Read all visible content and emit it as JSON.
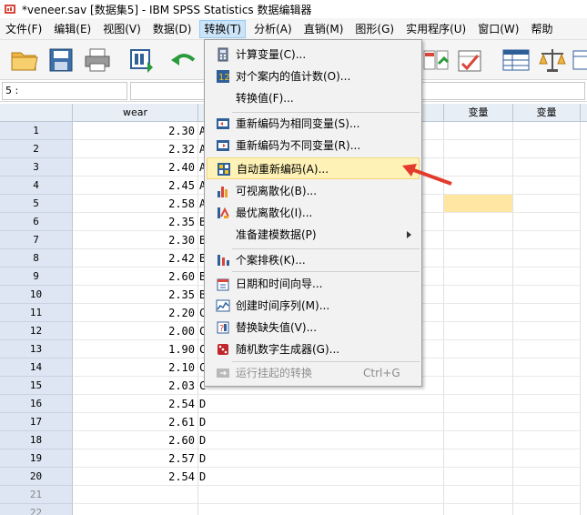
{
  "window": {
    "title": "*veneer.sav [数据集5] - IBM SPSS Statistics 数据编辑器"
  },
  "menubar": {
    "items": [
      "文件(F)",
      "编辑(E)",
      "视图(V)",
      "数据(D)",
      "转换(T)",
      "分析(A)",
      "直销(M)",
      "图形(G)",
      "实用程序(U)",
      "窗口(W)",
      "帮助"
    ],
    "active_index": 4
  },
  "addressbar": {
    "cell_ref": "5 :",
    "cell_value": ""
  },
  "grid": {
    "columns": [
      "wear",
      "变量",
      "变量"
    ],
    "rows": [
      {
        "n": "1",
        "wear": "2.30",
        "brand": "A"
      },
      {
        "n": "2",
        "wear": "2.32",
        "brand": "A"
      },
      {
        "n": "3",
        "wear": "2.40",
        "brand": "A"
      },
      {
        "n": "4",
        "wear": "2.45",
        "brand": "A"
      },
      {
        "n": "5",
        "wear": "2.58",
        "brand": "A"
      },
      {
        "n": "6",
        "wear": "2.35",
        "brand": "B"
      },
      {
        "n": "7",
        "wear": "2.30",
        "brand": "B"
      },
      {
        "n": "8",
        "wear": "2.42",
        "brand": "B"
      },
      {
        "n": "9",
        "wear": "2.60",
        "brand": "B"
      },
      {
        "n": "10",
        "wear": "2.35",
        "brand": "B"
      },
      {
        "n": "11",
        "wear": "2.20",
        "brand": "C"
      },
      {
        "n": "12",
        "wear": "2.00",
        "brand": "C"
      },
      {
        "n": "13",
        "wear": "1.90",
        "brand": "C"
      },
      {
        "n": "14",
        "wear": "2.10",
        "brand": "C"
      },
      {
        "n": "15",
        "wear": "2.03",
        "brand": "C"
      },
      {
        "n": "16",
        "wear": "2.54",
        "brand": "D"
      },
      {
        "n": "17",
        "wear": "2.61",
        "brand": "D"
      },
      {
        "n": "18",
        "wear": "2.60",
        "brand": "D"
      },
      {
        "n": "19",
        "wear": "2.57",
        "brand": "D"
      },
      {
        "n": "20",
        "wear": "2.54",
        "brand": "D"
      },
      {
        "n": "21",
        "wear": "",
        "brand": ""
      },
      {
        "n": "22",
        "wear": "",
        "brand": ""
      }
    ]
  },
  "transform_menu": {
    "items": [
      {
        "label": "计算变量(C)...",
        "icon": "calculator-icon"
      },
      {
        "label": "对个案内的值计数(O)...",
        "icon": "count-icon"
      },
      {
        "label": "转换值(F)...",
        "icon": ""
      },
      {
        "label": "重新编码为相同变量(S)...",
        "icon": "recode-same-icon"
      },
      {
        "label": "重新编码为不同变量(R)...",
        "icon": "recode-different-icon"
      },
      {
        "label": "自动重新编码(A)...",
        "icon": "auto-recode-icon",
        "highlighted": true
      },
      {
        "label": "可视离散化(B)...",
        "icon": "visual-binning-icon"
      },
      {
        "label": "最优离散化(I)...",
        "icon": "optimal-binning-icon"
      },
      {
        "label": "准备建模数据(P)",
        "icon": "",
        "submenu": true
      },
      {
        "label": "个案排秩(K)...",
        "icon": "rank-cases-icon"
      },
      {
        "label": "日期和时间向导...",
        "icon": "date-time-icon"
      },
      {
        "label": "创建时间序列(M)...",
        "icon": "time-series-icon"
      },
      {
        "label": "替换缺失值(V)...",
        "icon": "replace-missing-icon"
      },
      {
        "label": "随机数字生成器(G)...",
        "icon": "dice-icon"
      },
      {
        "label": "运行挂起的转换",
        "icon": "run-pending-icon",
        "shortcut": "Ctrl+G",
        "disabled": true
      }
    ]
  },
  "colors": {
    "accent_red": "#e23b2e",
    "highlight": "#fff2b6",
    "selected_cell": "#ffe7a3"
  }
}
